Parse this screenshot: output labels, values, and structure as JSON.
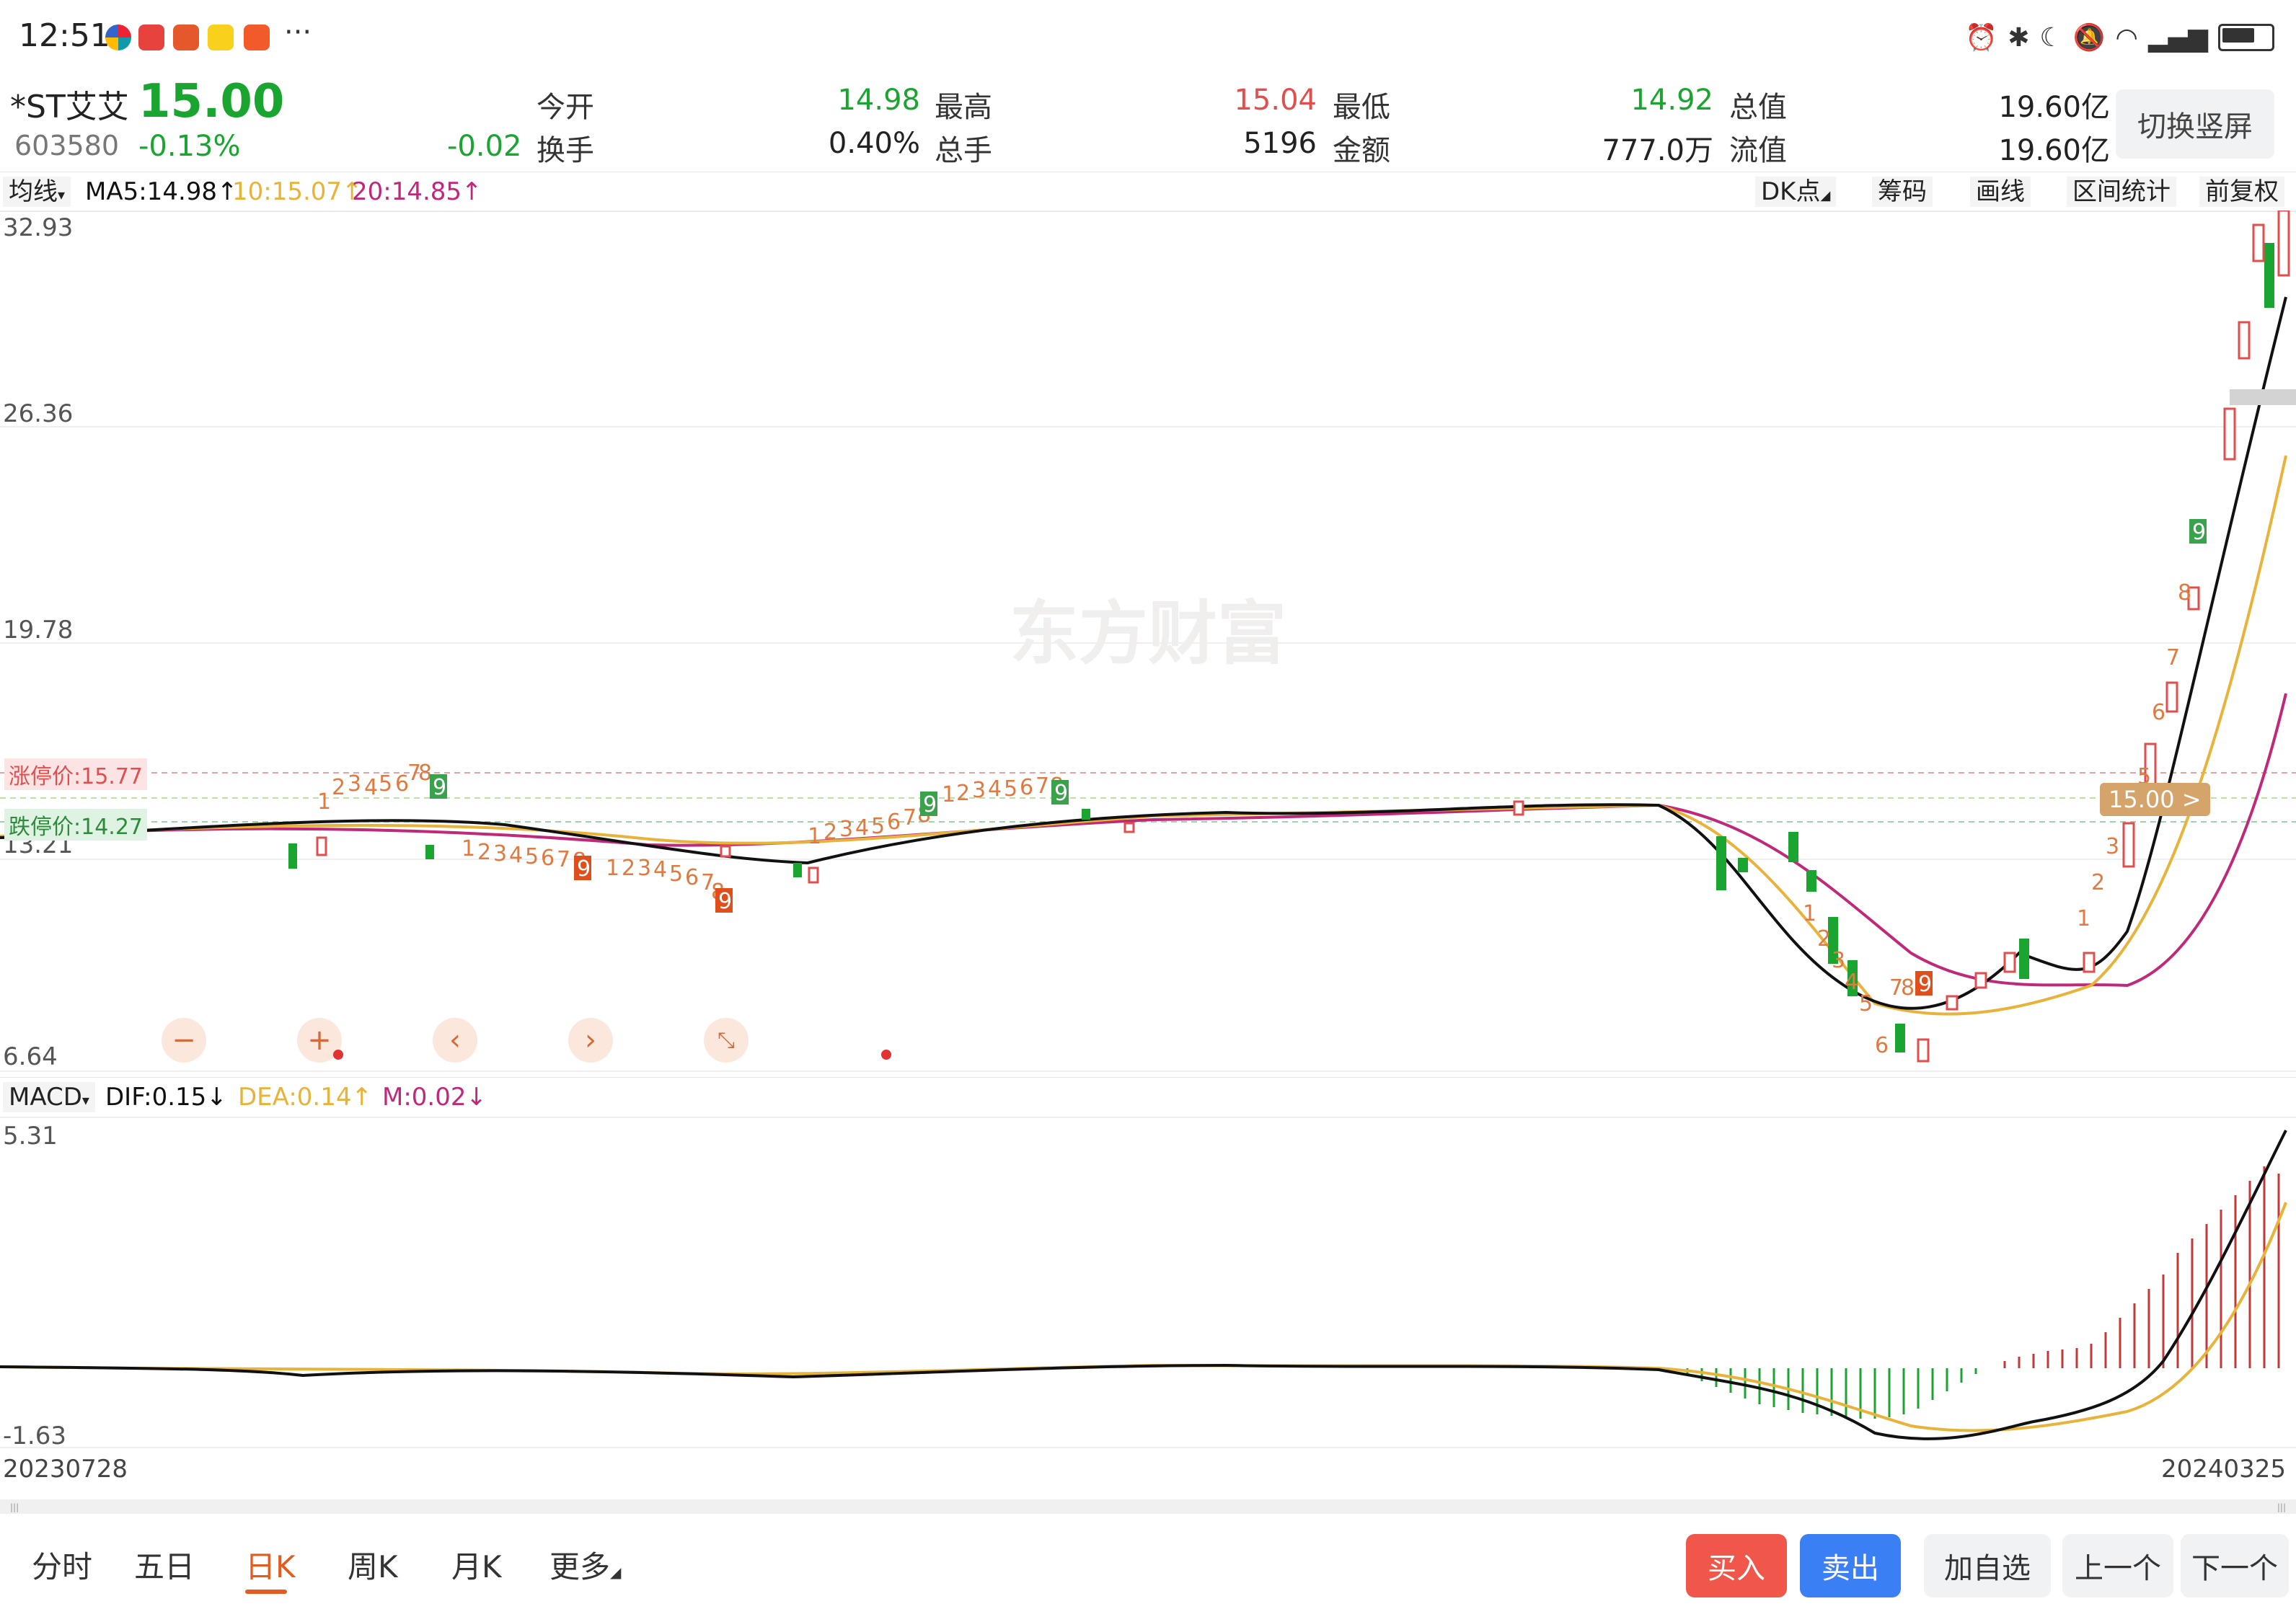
{
  "status_bar": {
    "time": "12:51"
  },
  "quote": {
    "name": "*ST艾艾",
    "code": "603580",
    "price": "15.00",
    "change_pct": "-0.13%",
    "change": "-0.02",
    "open_label": "今开",
    "open": "14.98",
    "high_label": "最高",
    "high": "15.04",
    "low_label": "最低",
    "low": "14.92",
    "total_value_label": "总值",
    "total_value": "19.60亿",
    "turnover_label": "换手",
    "turnover": "0.40%",
    "volume_label": "总手",
    "volume": "5196",
    "amount_label": "金额",
    "amount": "777.0万",
    "float_value_label": "流值",
    "float_value": "19.60亿",
    "switch_label": "切换竖屏"
  },
  "toolbar": {
    "line_type": "均线",
    "ma5": "MA5:14.98↑",
    "ma10": "10:15.07↑",
    "ma20": "20:14.85↑",
    "dk": "DK点",
    "chips": "筹码",
    "draw": "画线",
    "range_stats": "区间统计",
    "adjust": "前复权"
  },
  "kline": {
    "y_ticks": [
      "32.93",
      "26.36",
      "19.78",
      "13.21",
      "6.64"
    ],
    "limit_up": "涨停价:15.77",
    "limit_down": "跌停价:14.27",
    "current_price_tag": "15.00 >",
    "watermark": "东方财富"
  },
  "macd": {
    "label": "MACD",
    "dif": "DIF:0.15↓",
    "dea": "DEA:0.14↑",
    "m": "M:0.02↓",
    "y_top": "5.31",
    "y_bottom": "-1.63"
  },
  "x_axis": {
    "start": "20230728",
    "end": "20240325"
  },
  "bottom_nav": {
    "tabs": [
      "分时",
      "五日",
      "日K",
      "周K",
      "月K",
      "更多"
    ],
    "buy": "买入",
    "sell": "卖出",
    "add_watch": "加自选",
    "prev": "上一个",
    "next": "下一个"
  },
  "colors": {
    "up": "#e04e4e",
    "down": "#19a530",
    "accent": "#e35b1f",
    "ma5": "#111111",
    "ma10": "#e8b33a",
    "ma20": "#c0297a"
  }
}
